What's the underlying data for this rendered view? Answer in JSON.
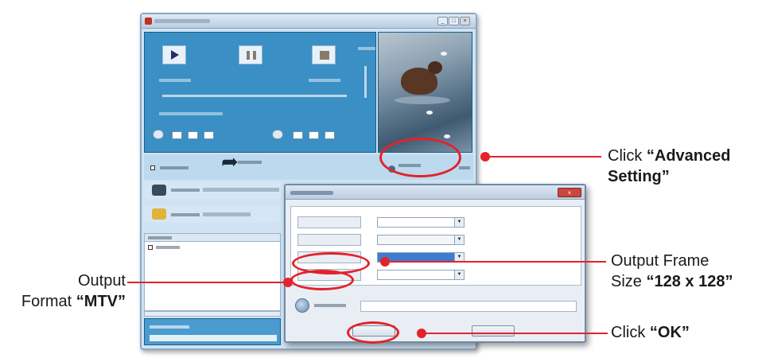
{
  "annotations": {
    "advanced": {
      "prefix": "Click ",
      "line1_bold": "“Advanced",
      "line2_bold": "Setting”"
    },
    "frame_size": {
      "line1": "Output Frame",
      "line2_prefix": "Size ",
      "value": "“128 x 128”"
    },
    "ok": {
      "prefix": "Click ",
      "value": "“OK”"
    },
    "format": {
      "line1": "Output",
      "line2_prefix": "Format ",
      "value": "“MTV”"
    }
  },
  "colors": {
    "annotation_red": "#e4222b",
    "player_blue": "#3a8fc4",
    "window_bg": "#cfe3f3"
  },
  "icons": [
    "close-icon",
    "arrow-right-icon",
    "gear-icon",
    "folder-icon",
    "film-icon",
    "browse-icon",
    "checkbox-icon"
  ]
}
